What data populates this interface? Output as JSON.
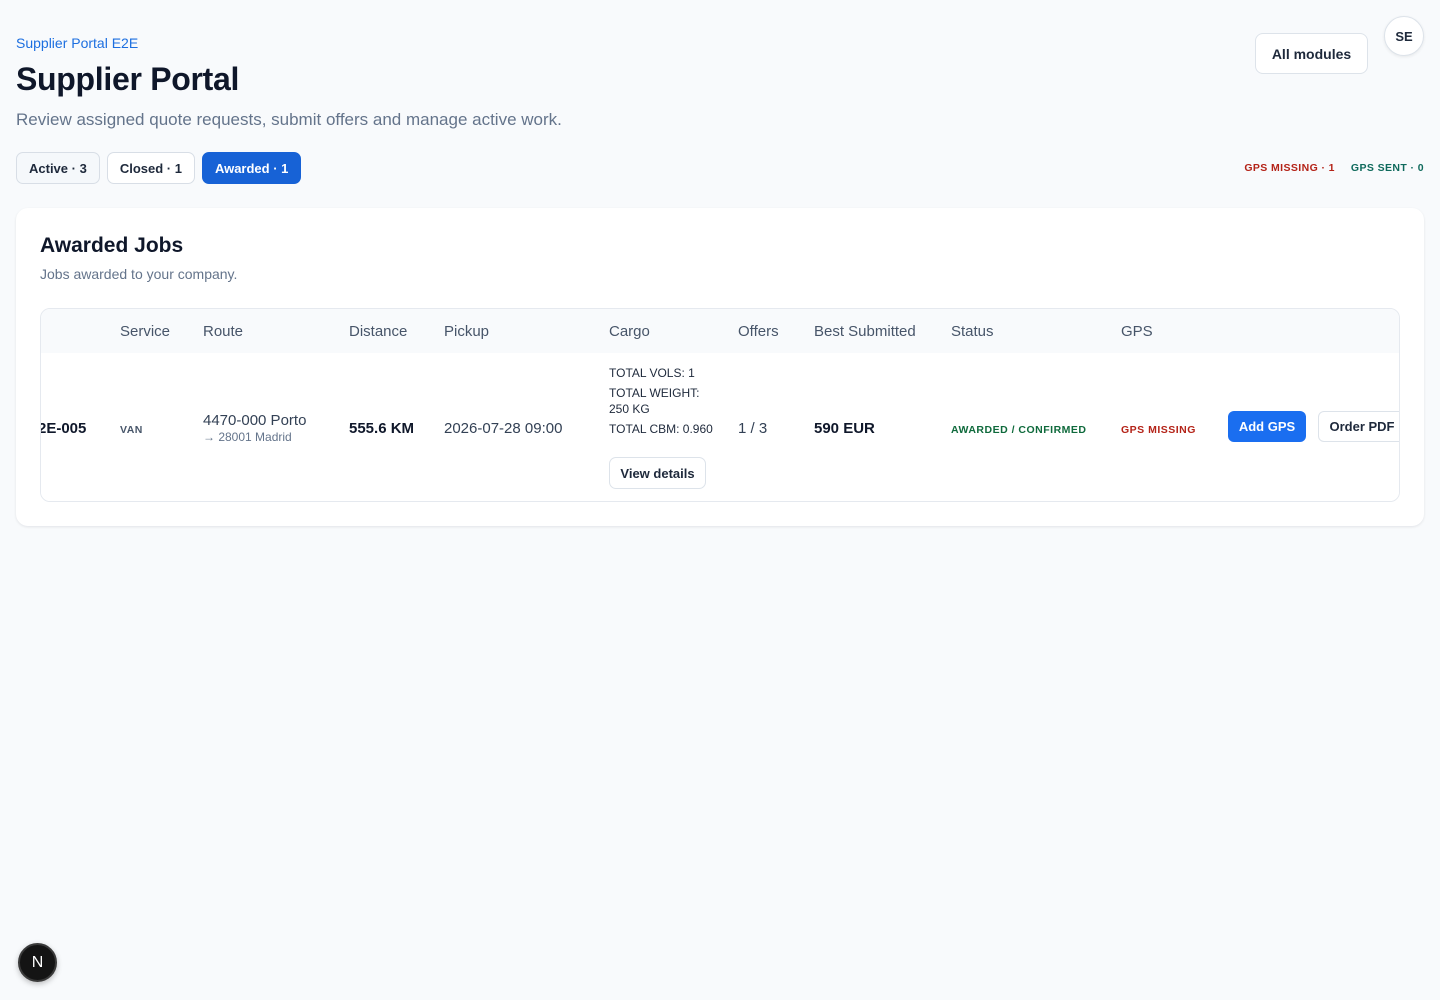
{
  "header": {
    "breadcrumb": "Supplier Portal E2E",
    "title": "Supplier Portal",
    "subtitle": "Review assigned quote requests, submit offers and manage active work.",
    "all_modules_label": "All modules",
    "avatar_initials": "SE"
  },
  "tabs": [
    {
      "label": "Active · 3",
      "active": false
    },
    {
      "label": "Closed · 1",
      "active": false
    },
    {
      "label": "Awarded · 1",
      "active": true
    }
  ],
  "gps_summary": {
    "missing": "GPS MISSING · 1",
    "sent": "GPS SENT · 0"
  },
  "card": {
    "title": "Awarded Jobs",
    "subtitle": "Jobs awarded to your company."
  },
  "table": {
    "columns": [
      "Service",
      "Route",
      "Distance",
      "Pickup",
      "Cargo",
      "Offers",
      "Best Submitted",
      "Status",
      "GPS"
    ],
    "rows": [
      {
        "job_id": "2E-005",
        "service": "VAN",
        "route_from": "4470-000 Porto",
        "route_to": "→ 28001 Madrid",
        "distance": "555.6 KM",
        "pickup": "2026-07-28 09:00",
        "cargo_vols": "TOTAL VOLS: 1",
        "cargo_weight": "TOTAL WEIGHT: 250 KG",
        "cargo_cbm": "TOTAL CBM: 0.960",
        "view_details_label": "View details",
        "offers": "1 / 3",
        "best_submitted": "590 EUR",
        "status": "AWARDED / CONFIRMED",
        "gps": "GPS MISSING",
        "add_gps_label": "Add GPS",
        "order_pdf_label": "Order PDF"
      }
    ]
  },
  "colors": {
    "accent": "#1762d6",
    "gps_missing": "#b42318",
    "gps_sent": "#0f6a5c",
    "status_awarded": "#0f6a3c"
  },
  "dev_badge": "N"
}
